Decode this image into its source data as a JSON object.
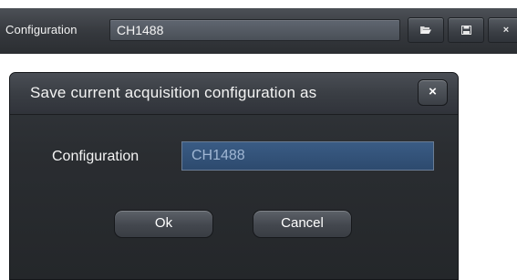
{
  "toolbar": {
    "label": "Configuration",
    "value": "CH1488",
    "buttons": {
      "open_icon": "folder-open-icon",
      "save_icon": "floppy-save-icon",
      "close_label": "×"
    }
  },
  "dialog": {
    "title": "Save current acquisition configuration as",
    "close_label": "×",
    "field_label": "Configuration",
    "field_value": "CH1488",
    "ok_label": "Ok",
    "cancel_label": "Cancel"
  },
  "colors": {
    "toolbar_bg": "#3a3d42",
    "dialog_bg": "#2a2d31",
    "field_selection": "#3a5c85",
    "text": "#f3f3f3"
  }
}
